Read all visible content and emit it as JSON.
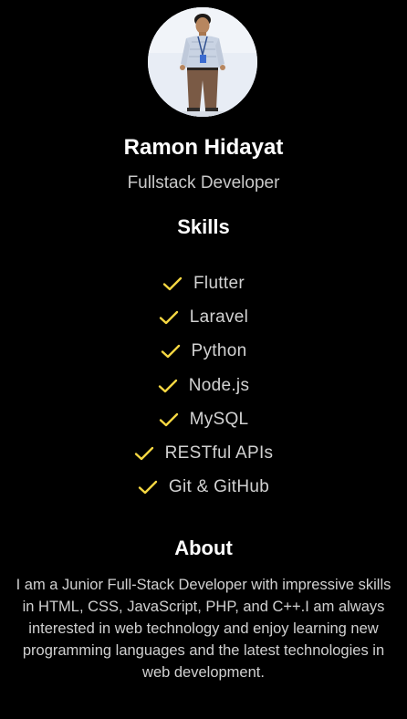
{
  "profile": {
    "avatar_icon": "profile-photo",
    "name": "Ramon Hidayat",
    "role": "Fullstack Developer"
  },
  "skills": {
    "title": "Skills",
    "check_icon": "check-icon",
    "check_color": "#f5d742",
    "items": [
      "Flutter",
      "Laravel",
      "Python",
      "Node.js",
      "MySQL",
      "RESTful APIs",
      "Git & GitHub"
    ]
  },
  "about": {
    "title": "About",
    "text": "I am a Junior Full-Stack Developer with impressive skills in HTML, CSS, JavaScript, PHP, and C++.I am always interested in web technology and enjoy learning new programming languages and the latest technologies in web development."
  },
  "colors": {
    "background": "#000000",
    "heading": "#ffffff",
    "body_text": "#d0d0d0"
  }
}
